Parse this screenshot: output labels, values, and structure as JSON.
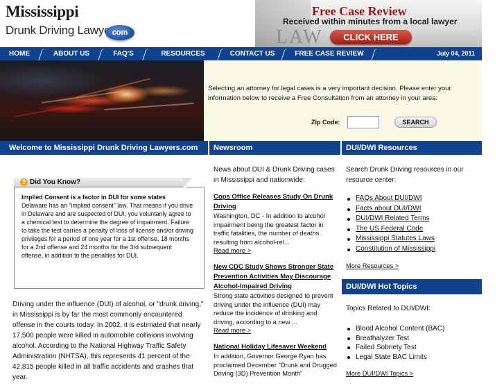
{
  "header": {
    "logo_title": "Mississippi",
    "logo_subtitle": "Drunk Driving Lawyers.",
    "logo_badge": "com"
  },
  "banner": {
    "title": "Free Case Review",
    "subtitle": "Received within minutes from a local lawyer",
    "button": "CLICK HERE",
    "background_word": "LAW"
  },
  "nav": {
    "items": [
      {
        "label": "HOME"
      },
      {
        "label": "ABOUT US"
      },
      {
        "label": "FAQ'S"
      },
      {
        "label": "RESOURCES"
      },
      {
        "label": "CONTACT US"
      },
      {
        "label": "FREE CASE REVIEW"
      }
    ],
    "date": "July 04, 2011"
  },
  "hero": {
    "text": "Selecting an attorney for legal cases is a very important decision. Please enter your information below to receive a Free Consultation from an attorney in your area:",
    "zip_label": "Zip Code:",
    "zip_value": "",
    "search_button": "SEARCH"
  },
  "sections": {
    "welcome": "Welcome to Mississippi Drunk Driving Lawyers.com",
    "newsroom": "Newsroom",
    "resources": "DUI/DWI Resources",
    "hot_topics": "DUI/DWI Hot Topics"
  },
  "did_you_know": {
    "title": "Did You Know?",
    "icon": "?",
    "heading": "Implied Consent is a factor in DUI for some states",
    "body": "Delaware has an \"implied consent\" law. That means if you drive in Delaware and are suspected of DUI, you voluntarily agree to a chemical test to determine the degree of impairment. Failure to take the test carries a penalty of loss of license and/or driving privileges for a period of one year for a 1st offense, 18 months for a 2nd offense and 24 months for the 3rd subsequent offense, in addition to the penalties for DUI."
  },
  "intro": "Driving under the influence (DUI) of alcohol, or \"drunk driving,\" in Mississippi is by far the most commonly encountered offense in the courts today. In 2002, it is estimated that nearly 17,500 people were killed in automobile collisions involving alcohol. According to the National Highway Traffic Safety Administration (NHTSA), this represents 41 percent of the 42,815 people killed in all traffic accidents and crashes that year.",
  "newsroom": {
    "intro": "News about DUI & Drunk Driving cases in Mississippi and nationwide:",
    "items": [
      {
        "title": "Cops Office Releases Study On Drunk Driving",
        "desc": "Washington, DC - In addition to alcohol impairment being the greatest factor in traffic fatalities, the number of deaths resulting from alcohol-rel...",
        "more": "Read more >"
      },
      {
        "title": "New CDC Study Shows Stronger State Prevention Activities May Discourage Alcohol-Impaired Driving",
        "desc": "Strong state activities designed to prevent driving under the influence (DUI) may reduce the incidence of drinking and driving, according to a new ...",
        "more": "Read more >"
      },
      {
        "title": "National Holiday Lifesaver Weekend",
        "desc": "In addition, Governor George Ryan has proclaimed December \"Drunk and Drugged Driving (3D) Prevention Month\"",
        "more": ""
      }
    ]
  },
  "resources": {
    "intro": "Search Drunk Driving resources in our resource center:",
    "links": [
      {
        "label": "FAQs About DUI/DWI"
      },
      {
        "label": "Facts about DUI/DWI"
      },
      {
        "label": "DUI/DWI Related Terms"
      },
      {
        "label": "The US Federal Code"
      },
      {
        "label": "Mississippi Statutes Laws"
      },
      {
        "label": "Constitution of Mississippi"
      }
    ],
    "more": "More Resources >"
  },
  "hot_topics": {
    "intro": "Topics Related to DUI/DWI:",
    "items": [
      {
        "label": "Blood Alcohol Content (BAC)"
      },
      {
        "label": "Breathalyzer Test"
      },
      {
        "label": "Failed Sobriety Test"
      },
      {
        "label": "Legal State BAC Limits"
      }
    ],
    "more": "More DUI/DWI Topics >"
  },
  "colors": {
    "nav_blue": "#11428f",
    "hero_bg": "#fbf8e6",
    "banner_red": "#9b1515"
  }
}
